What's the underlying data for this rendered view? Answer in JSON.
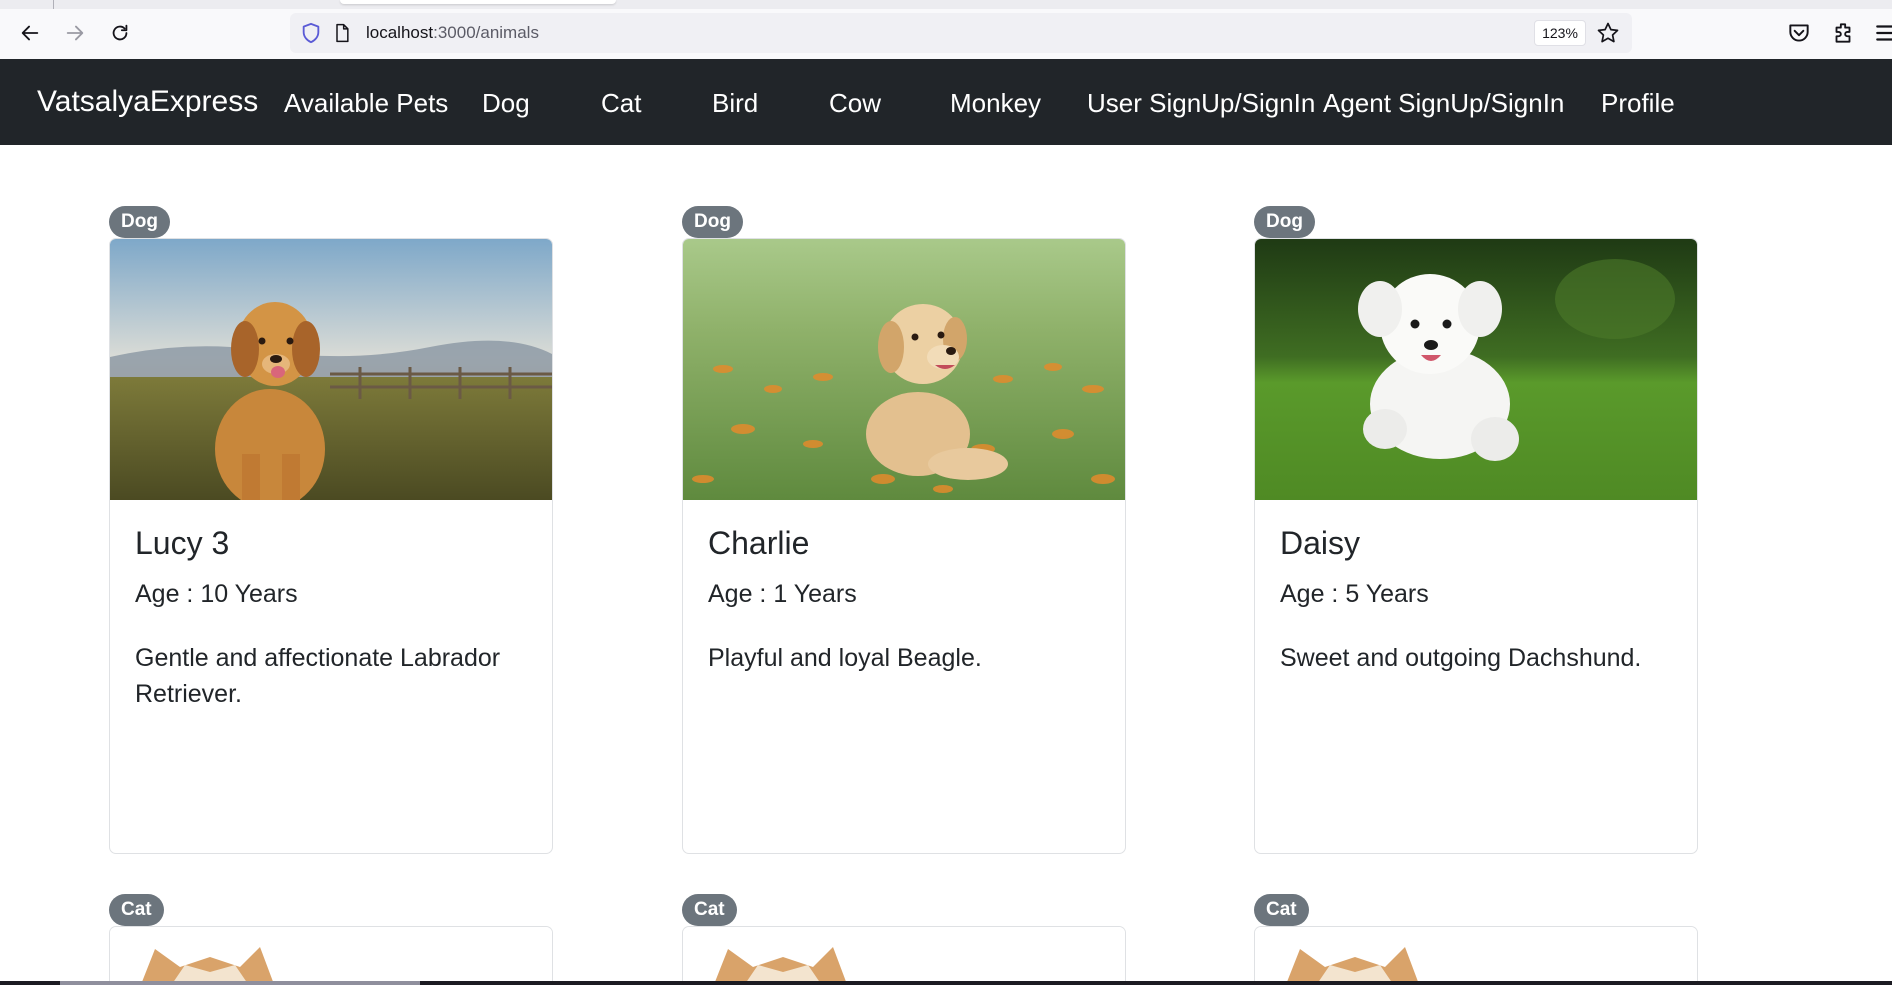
{
  "browser": {
    "url_host": "localhost",
    "url_path": ":3000/animals",
    "zoom": "123%",
    "icons": [
      "back-arrow-icon",
      "forward-arrow-icon",
      "reload-icon",
      "shield-icon",
      "page-icon",
      "star-icon",
      "pocket-icon",
      "extensions-icon",
      "menu-icon"
    ]
  },
  "navbar": {
    "brand": "VatsalyaExpress",
    "links": [
      "Available Pets",
      "Dog",
      "Cat",
      "Bird",
      "Cow",
      "Monkey",
      "User SignUp/SignIn",
      "Agent SignUp/SignIn",
      "Profile"
    ]
  },
  "cards": [
    {
      "category": "Dog",
      "name": "Lucy 3",
      "age": "Age : 10 Years",
      "description": "Gentle and affectionate Labrador Retriever.",
      "image": "golden-retriever-photo"
    },
    {
      "category": "Dog",
      "name": "Charlie",
      "age": "Age : 1 Years",
      "description": "Playful and loyal Beagle.",
      "image": "puppy-in-flowers-photo"
    },
    {
      "category": "Dog",
      "name": "Daisy",
      "age": "Age : 5 Years",
      "description": "Sweet and outgoing Dachshund.",
      "image": "white-poodle-photo"
    }
  ],
  "next_row": [
    {
      "category": "Cat",
      "image": "cat-photo"
    },
    {
      "category": "Cat",
      "image": "cat-photo"
    },
    {
      "category": "Cat",
      "image": "cat-photo"
    }
  ],
  "colors": {
    "navbar_bg": "#212529",
    "badge_bg": "#6c757d",
    "card_border": "#dfe1e4"
  }
}
